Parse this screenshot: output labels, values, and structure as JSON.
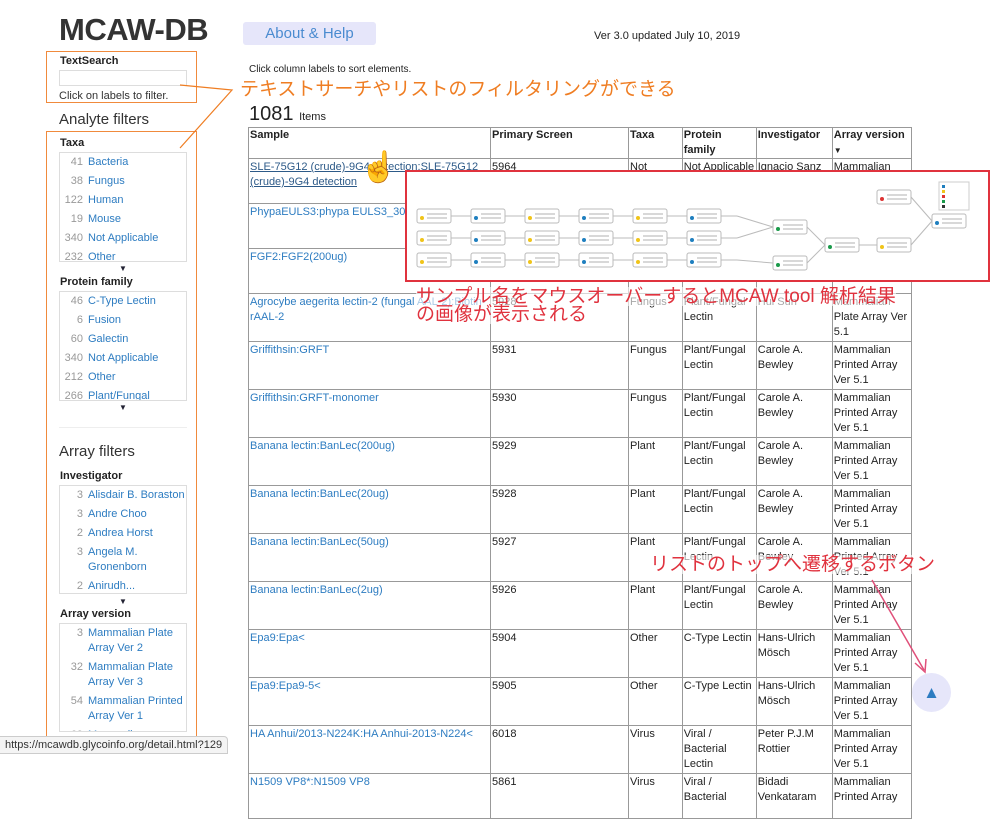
{
  "app": {
    "logo": "MCAW-DB",
    "about_label": "About & Help",
    "version": "Ver 3.0 updated July 10, 2019",
    "sort_hint": "Click column labels to sort elements.",
    "item_count": "1081",
    "items_label": "Items"
  },
  "search": {
    "label": "TextSearch",
    "value": "",
    "hint": "Click on labels to filter."
  },
  "analyte": {
    "title": "Analyte filters",
    "taxa": {
      "label": "Taxa",
      "items": [
        {
          "count": "41",
          "label": "Bacteria"
        },
        {
          "count": "38",
          "label": "Fungus"
        },
        {
          "count": "122",
          "label": "Human"
        },
        {
          "count": "19",
          "label": "Mouse"
        },
        {
          "count": "340",
          "label": "Not Applicable"
        },
        {
          "count": "232",
          "label": "Other"
        }
      ]
    },
    "protein": {
      "label": "Protein family",
      "items": [
        {
          "count": "46",
          "label": "C-Type Lectin"
        },
        {
          "count": "6",
          "label": "Fusion"
        },
        {
          "count": "60",
          "label": "Galectin"
        },
        {
          "count": "340",
          "label": "Not Applicable"
        },
        {
          "count": "212",
          "label": "Other"
        },
        {
          "count": "266",
          "label": "Plant/Fungal"
        }
      ]
    }
  },
  "array": {
    "title": "Array filters",
    "investigator": {
      "label": "Investigator",
      "items": [
        {
          "count": "3",
          "label": "Alisdair B. Boraston"
        },
        {
          "count": "3",
          "label": "Andre Choo"
        },
        {
          "count": "2",
          "label": "Andrea Horst"
        },
        {
          "count": "3",
          "label": "Angela M. Gronenborn"
        },
        {
          "count": "2",
          "label": "Anirudh..."
        }
      ]
    },
    "version": {
      "label": "Array version",
      "items": [
        {
          "count": "3",
          "label": "Mammalian Plate Array Ver 2"
        },
        {
          "count": "32",
          "label": "Mammalian Plate Array Ver 3"
        },
        {
          "count": "54",
          "label": "Mammalian Printed Array Ver 1"
        },
        {
          "count": "69",
          "label": "Mammalian"
        }
      ]
    }
  },
  "table": {
    "headers": [
      "Sample",
      "Primary Screen",
      "Taxa",
      "Protein family",
      "Investigator",
      "Array version"
    ],
    "sort_icon": "caret-down",
    "rows": [
      [
        "SLE-75G12 (crude)-9G4 detection:SLE-75G12 (crude)-9G4 detection",
        "5964",
        "Not Applicable",
        "Not Applicable",
        "Ignacio Sanz",
        "Mammalian Printed Array"
      ],
      [
        "PhypaEULS3:phypa EULS3_300",
        "",
        "",
        "",
        "",
        ""
      ],
      [
        "FGF2:FGF2(200ug)",
        "",
        "",
        "",
        "",
        ""
      ],
      [
        "Agrocybe aegerita lectin-2 (fungal AAL-2):Biotin-rAAL-2",
        "5928",
        "Fungus",
        "Plant/Fungal Lectin",
        "Hui Sun",
        "Mammalian Plate Array Ver 5.1"
      ],
      [
        "Griffithsin:GRFT",
        "5931",
        "Fungus",
        "Plant/Fungal Lectin",
        "Carole A. Bewley",
        "Mammalian Printed Array Ver 5.1"
      ],
      [
        "Griffithsin:GRFT-monomer",
        "5930",
        "Fungus",
        "Plant/Fungal Lectin",
        "Carole A. Bewley",
        "Mammalian Printed Array Ver 5.1"
      ],
      [
        "Banana lectin:BanLec(200ug)",
        "5929",
        "Plant",
        "Plant/Fungal Lectin",
        "Carole A. Bewley",
        "Mammalian Printed Array Ver 5.1"
      ],
      [
        "Banana lectin:BanLec(20ug)",
        "5928",
        "Plant",
        "Plant/Fungal Lectin",
        "Carole A. Bewley",
        "Mammalian Printed Array Ver 5.1"
      ],
      [
        "Banana lectin:BanLec(50ug)",
        "5927",
        "Plant",
        "Plant/Fungal Lectin",
        "Carole A. Bewley",
        "Mammalian Printed Array Ver 5.1"
      ],
      [
        "Banana lectin:BanLec(2ug)",
        "5926",
        "Plant",
        "Plant/Fungal Lectin",
        "Carole A. Bewley",
        "Mammalian Printed Array Ver 5.1"
      ],
      [
        "Epa9:Epa<",
        "5904",
        "Other",
        "C-Type Lectin",
        "Hans-Ulrich Mösch",
        "Mammalian Printed Array Ver 5.1"
      ],
      [
        "Epa9:Epa9-5<",
        "5905",
        "Other",
        "C-Type Lectin",
        "Hans-Ulrich Mösch",
        "Mammalian Printed Array Ver 5.1"
      ],
      [
        "HA Anhui/2013-N224K:HA Anhui-2013-N224<",
        "6018",
        "Virus",
        "Viral / Bacterial Lectin",
        "Peter P.J.M Rottier",
        "Mammalian Printed Array Ver 5.1"
      ],
      [
        "N1509 VP8*:N1509 VP8",
        "5861",
        "Virus",
        "Viral / Bacterial",
        "Bidadi Venkataram",
        "Mammalian Printed Array"
      ]
    ]
  },
  "annotations": {
    "filter": "テキストサーチやリストのフィルタリングができる",
    "hover_line1": "サンプル名をマウスオーバーするとMCAW tool 解析結果",
    "hover_line2": "の画像が表示される",
    "backtop": "リストのトップへ遷移するボタン"
  },
  "colors": {
    "annotation_orange": "#ef7d22",
    "annotation_red": "#e0323e",
    "link": "#2d7cc1",
    "button_bg": "#e6e6fa"
  },
  "status_url": "https://mcawdb.glycoinfo.org/detail.html?129",
  "back_to_top_icon": "triangle-up"
}
